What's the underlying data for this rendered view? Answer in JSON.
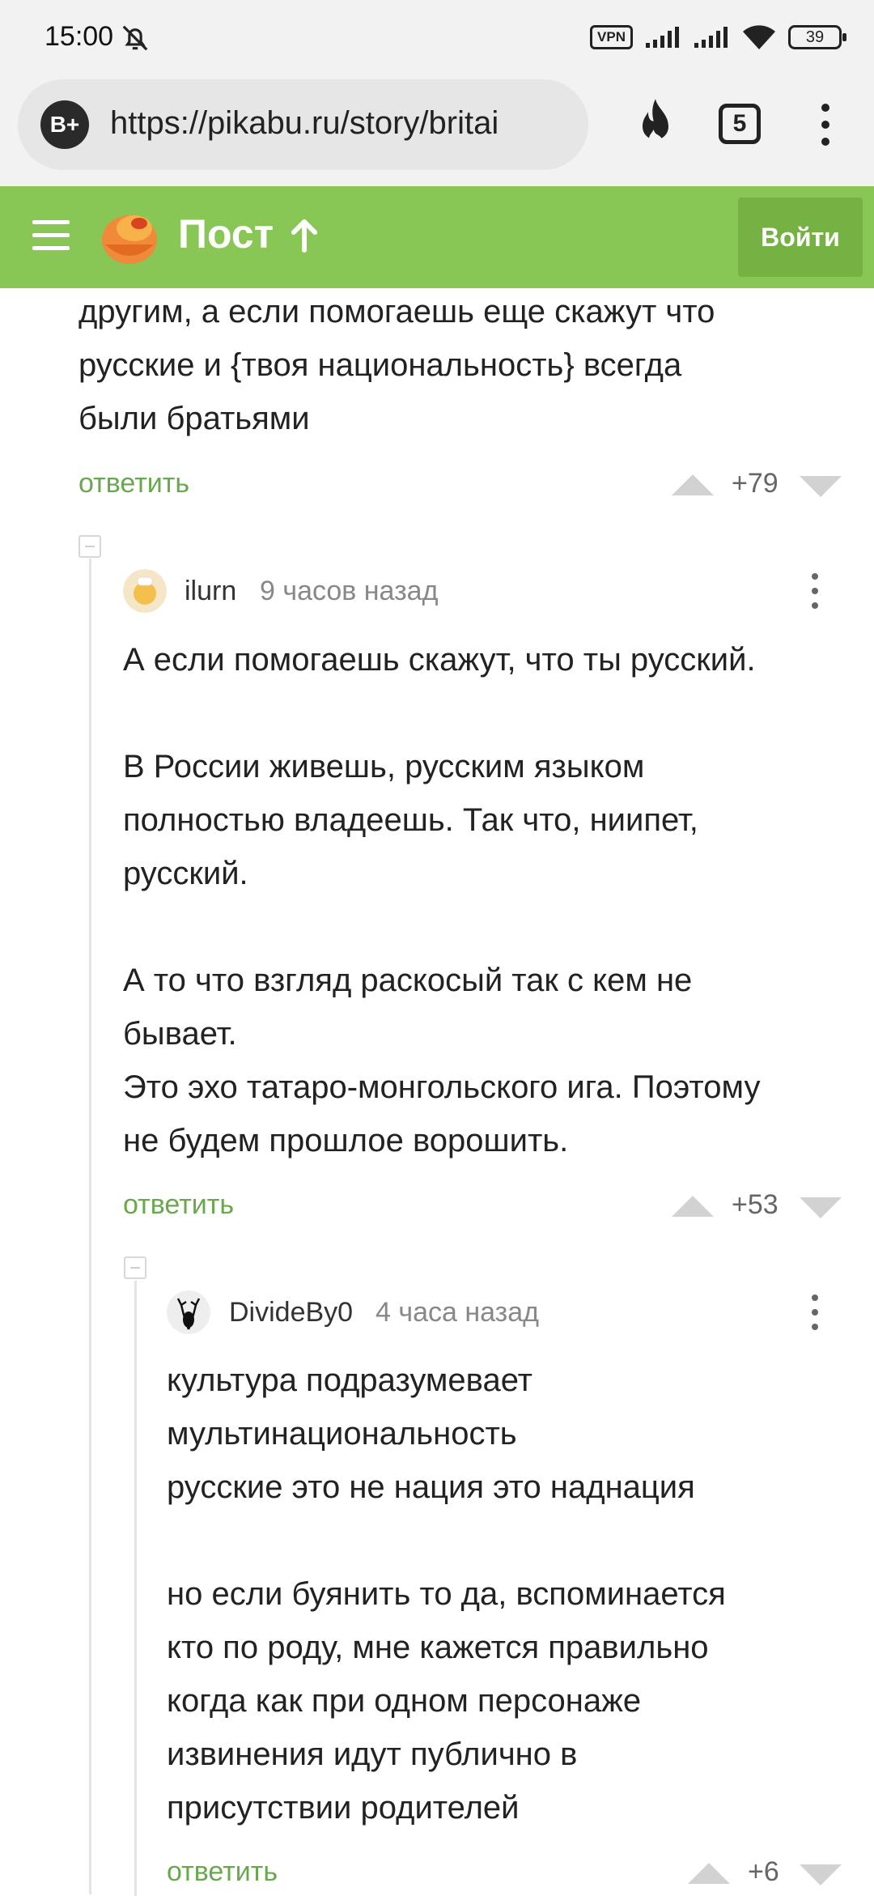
{
  "status_bar": {
    "time": "15:00",
    "vpn": "VPN",
    "battery": "39"
  },
  "browser": {
    "badge": "B+",
    "url": "https://pikabu.ru/story/britai",
    "tabs_count": "5"
  },
  "header": {
    "title": "Пост",
    "login_label": "Войти",
    "accent": "#88c655"
  },
  "comments": [
    {
      "text": "другим, а если помогаешь еще скажут что\nрусские и {твоя национальность} всегда\nбыли братьями",
      "reply_label": "ответить",
      "score": "+79"
    },
    {
      "author": "ilurn",
      "time": "9 часов назад",
      "text": "А если помогаешь скажут, что ты русский.\n\nВ России живешь, русским языком\nполностью владеешь. Так что, ниипет,\nрусский.\n\nА то что взгляд раскосый так с кем не\nбывает.\nЭто эхо татаро-монгольского ига. Поэтому\nне будем прошлое ворошить.",
      "reply_label": "ответить",
      "score": "+53"
    },
    {
      "author": "DivideBy0",
      "time": "4 часа назад",
      "text": "культура подразумевает\nмультинациональность\nрусские это не нация это наднация\n\nно если буянить то да, вспоминается\nкто по роду, мне кажется правильно\nкогда как при одном персонаже\nизвинения идут публично в\nприсутствии родителей",
      "reply_label": "ответить",
      "score": "+6"
    }
  ]
}
